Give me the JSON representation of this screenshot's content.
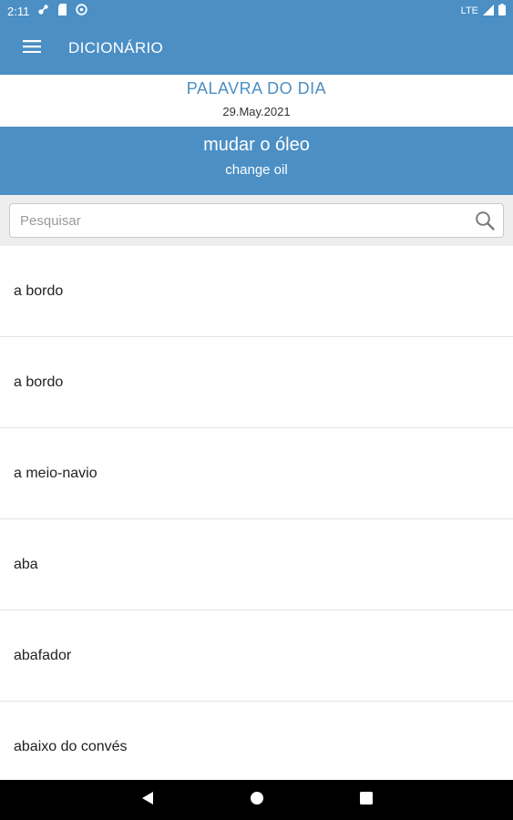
{
  "status_bar": {
    "time": "2:11",
    "network": "LTE",
    "icons": [
      "settings-notification-icon",
      "sd-card-icon",
      "sync-icon",
      "signal-icon",
      "battery-icon"
    ]
  },
  "app_bar": {
    "title": "DICIONÁRIO",
    "menu_icon": "hamburger-menu-icon"
  },
  "word_of_day": {
    "label": "PALAVRA DO DIA",
    "date": "29.May.2021",
    "word": "mudar o óleo",
    "translation": "change oil"
  },
  "search": {
    "placeholder": "Pesquisar",
    "value": "",
    "icon": "search-icon"
  },
  "word_list": [
    "a bordo",
    "a bordo",
    "a meio-navio",
    "aba",
    "abafador",
    "abaixo do convés"
  ],
  "nav_bar": {
    "buttons": [
      "back-icon",
      "home-icon",
      "recents-icon"
    ]
  },
  "colors": {
    "primary": "#4b8fc5",
    "search_background": "#eeeeee",
    "divider": "#e3e3e3",
    "nav_bar": "#000000"
  }
}
